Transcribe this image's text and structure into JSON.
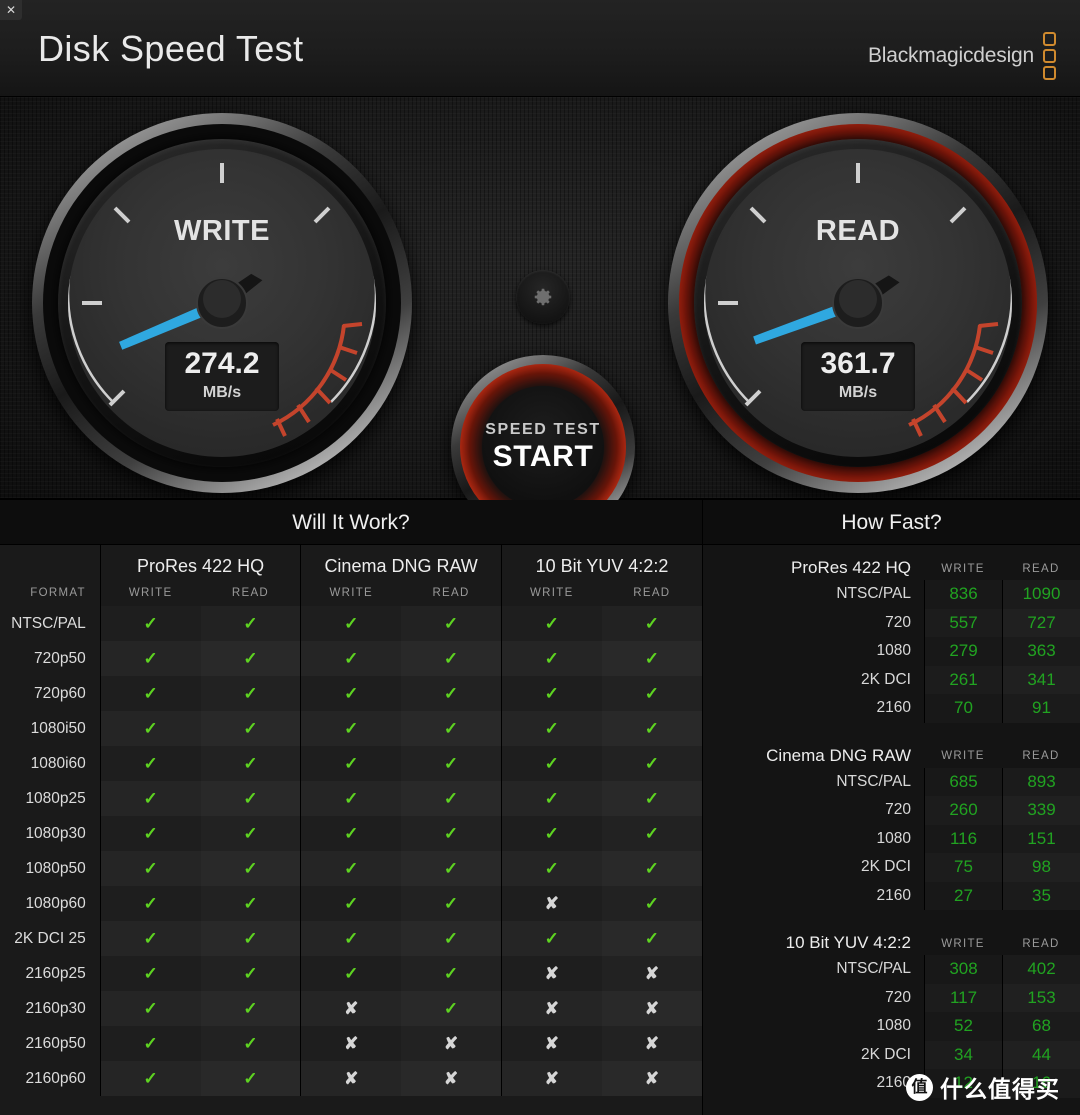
{
  "window": {
    "close_label": "✕"
  },
  "header": {
    "title": "Disk Speed Test",
    "brand": "Blackmagicdesign"
  },
  "gauges": {
    "write": {
      "label": "WRITE",
      "value": "274.2",
      "unit": "MB/s",
      "angle_deg": -22
    },
    "read": {
      "label": "READ",
      "value": "361.7",
      "unit": "MB/s",
      "angle_deg": -19
    }
  },
  "controls": {
    "gear_icon": "gear-icon",
    "start_sub": "SPEED TEST",
    "start_main": "START"
  },
  "will_it_work": {
    "title": "Will It Work?",
    "format_header": "FORMAT",
    "groups": [
      "ProRes 422 HQ",
      "Cinema DNG RAW",
      "10 Bit YUV 4:2:2"
    ],
    "sub_headers": [
      "WRITE",
      "READ"
    ],
    "yes_glyph": "✓",
    "no_glyph": "✘",
    "rows": [
      {
        "format": "NTSC/PAL",
        "marks": [
          true,
          true,
          true,
          true,
          true,
          true
        ]
      },
      {
        "format": "720p50",
        "marks": [
          true,
          true,
          true,
          true,
          true,
          true
        ]
      },
      {
        "format": "720p60",
        "marks": [
          true,
          true,
          true,
          true,
          true,
          true
        ]
      },
      {
        "format": "1080i50",
        "marks": [
          true,
          true,
          true,
          true,
          true,
          true
        ]
      },
      {
        "format": "1080i60",
        "marks": [
          true,
          true,
          true,
          true,
          true,
          true
        ]
      },
      {
        "format": "1080p25",
        "marks": [
          true,
          true,
          true,
          true,
          true,
          true
        ]
      },
      {
        "format": "1080p30",
        "marks": [
          true,
          true,
          true,
          true,
          true,
          true
        ]
      },
      {
        "format": "1080p50",
        "marks": [
          true,
          true,
          true,
          true,
          true,
          true
        ]
      },
      {
        "format": "1080p60",
        "marks": [
          true,
          true,
          true,
          true,
          false,
          true
        ]
      },
      {
        "format": "2K DCI 25",
        "marks": [
          true,
          true,
          true,
          true,
          true,
          true
        ]
      },
      {
        "format": "2160p25",
        "marks": [
          true,
          true,
          true,
          true,
          false,
          false
        ]
      },
      {
        "format": "2160p30",
        "marks": [
          true,
          true,
          false,
          true,
          false,
          false
        ]
      },
      {
        "format": "2160p50",
        "marks": [
          true,
          true,
          false,
          false,
          false,
          false
        ]
      },
      {
        "format": "2160p60",
        "marks": [
          true,
          true,
          false,
          false,
          false,
          false
        ]
      }
    ]
  },
  "how_fast": {
    "title": "How Fast?",
    "col_write": "WRITE",
    "col_read": "READ",
    "groups": [
      {
        "name": "ProRes 422 HQ",
        "rows": [
          {
            "res": "NTSC/PAL",
            "write": "836",
            "read": "1090"
          },
          {
            "res": "720",
            "write": "557",
            "read": "727"
          },
          {
            "res": "1080",
            "write": "279",
            "read": "363"
          },
          {
            "res": "2K DCI",
            "write": "261",
            "read": "341"
          },
          {
            "res": "2160",
            "write": "70",
            "read": "91"
          }
        ]
      },
      {
        "name": "Cinema DNG RAW",
        "rows": [
          {
            "res": "NTSC/PAL",
            "write": "685",
            "read": "893"
          },
          {
            "res": "720",
            "write": "260",
            "read": "339"
          },
          {
            "res": "1080",
            "write": "116",
            "read": "151"
          },
          {
            "res": "2K DCI",
            "write": "75",
            "read": "98"
          },
          {
            "res": "2160",
            "write": "27",
            "read": "35"
          }
        ]
      },
      {
        "name": "10 Bit YUV 4:2:2",
        "rows": [
          {
            "res": "NTSC/PAL",
            "write": "308",
            "read": "402"
          },
          {
            "res": "720",
            "write": "117",
            "read": "153"
          },
          {
            "res": "1080",
            "write": "52",
            "read": "68"
          },
          {
            "res": "2K DCI",
            "write": "34",
            "read": "44"
          },
          {
            "res": "2160",
            "write": "12",
            "read": "16"
          }
        ]
      }
    ]
  },
  "watermark": {
    "badge": "值",
    "text": "什么值得买"
  },
  "colors": {
    "accent_red": "#cf3317",
    "needle_blue": "#2fa8e0",
    "check_green": "#5ed321",
    "value_green": "#21a321",
    "brand_orange": "#d08a2e"
  }
}
